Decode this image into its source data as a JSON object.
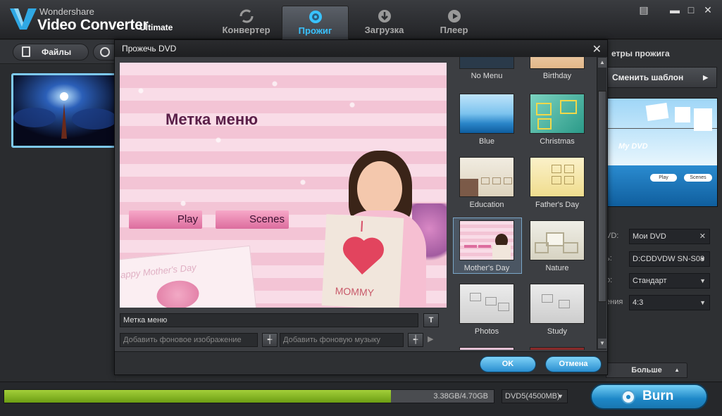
{
  "app": {
    "brand_top": "Wondershare",
    "brand_main": "Video Converter",
    "brand_edition": "Ultimate"
  },
  "nav": {
    "tabs": [
      {
        "label": "Конвертер",
        "icon": "convert-icon"
      },
      {
        "label": "Прожиг",
        "icon": "burn-disc-icon",
        "active": true
      },
      {
        "label": "Загрузка",
        "icon": "download-icon"
      },
      {
        "label": "Плеер",
        "icon": "play-icon"
      }
    ]
  },
  "toolbar": {
    "files_label": "Файлы"
  },
  "right_panel": {
    "title": "етры прожига",
    "change_template": "Сменить шаблон",
    "preview_title": "My DVD",
    "preview_play": "Play",
    "preview_scenes": "Scenes",
    "fields": [
      {
        "label": "VD:",
        "value": "Мои DVD"
      },
      {
        "label": "ь:",
        "value": "D:CDDVDW SN-S08"
      },
      {
        "label": "о:",
        "value": "Стандарт"
      },
      {
        "label": "ения",
        "value": "4:3"
      }
    ],
    "more_label": "Больше"
  },
  "dialog": {
    "title": "Прожечь DVD",
    "preview": {
      "menu_label": "Метка меню",
      "play_label": "Play",
      "scenes_label": "Scenes",
      "card_text": "I",
      "card_bottom": "MOMMY",
      "bg_text": "appy Mother's Day"
    },
    "menu_label_input": "Метка меню",
    "text_button": "T",
    "add_bg_image_placeholder": "Добавить фоновое изображение",
    "add_bg_music_placeholder": "Добавить фоновую музыку",
    "templates": [
      {
        "name": "No Menu"
      },
      {
        "name": "Birthday"
      },
      {
        "name": "Blue"
      },
      {
        "name": "Christmas"
      },
      {
        "name": "Education"
      },
      {
        "name": "Father's Day"
      },
      {
        "name": "Mother's Day",
        "selected": true
      },
      {
        "name": "Nature"
      },
      {
        "name": "Photos"
      },
      {
        "name": "Study"
      }
    ],
    "ok_label": "OK",
    "cancel_label": "Отмена"
  },
  "bottom": {
    "progress_fraction": 0.79,
    "progress_text": "3.38GB/4.70GB",
    "disc_type": "DVD5(4500MB)",
    "burn_label": "Burn"
  },
  "colors": {
    "accent": "#39c2ff",
    "progress": "#8cbf26",
    "burn": "#1d87c7"
  }
}
